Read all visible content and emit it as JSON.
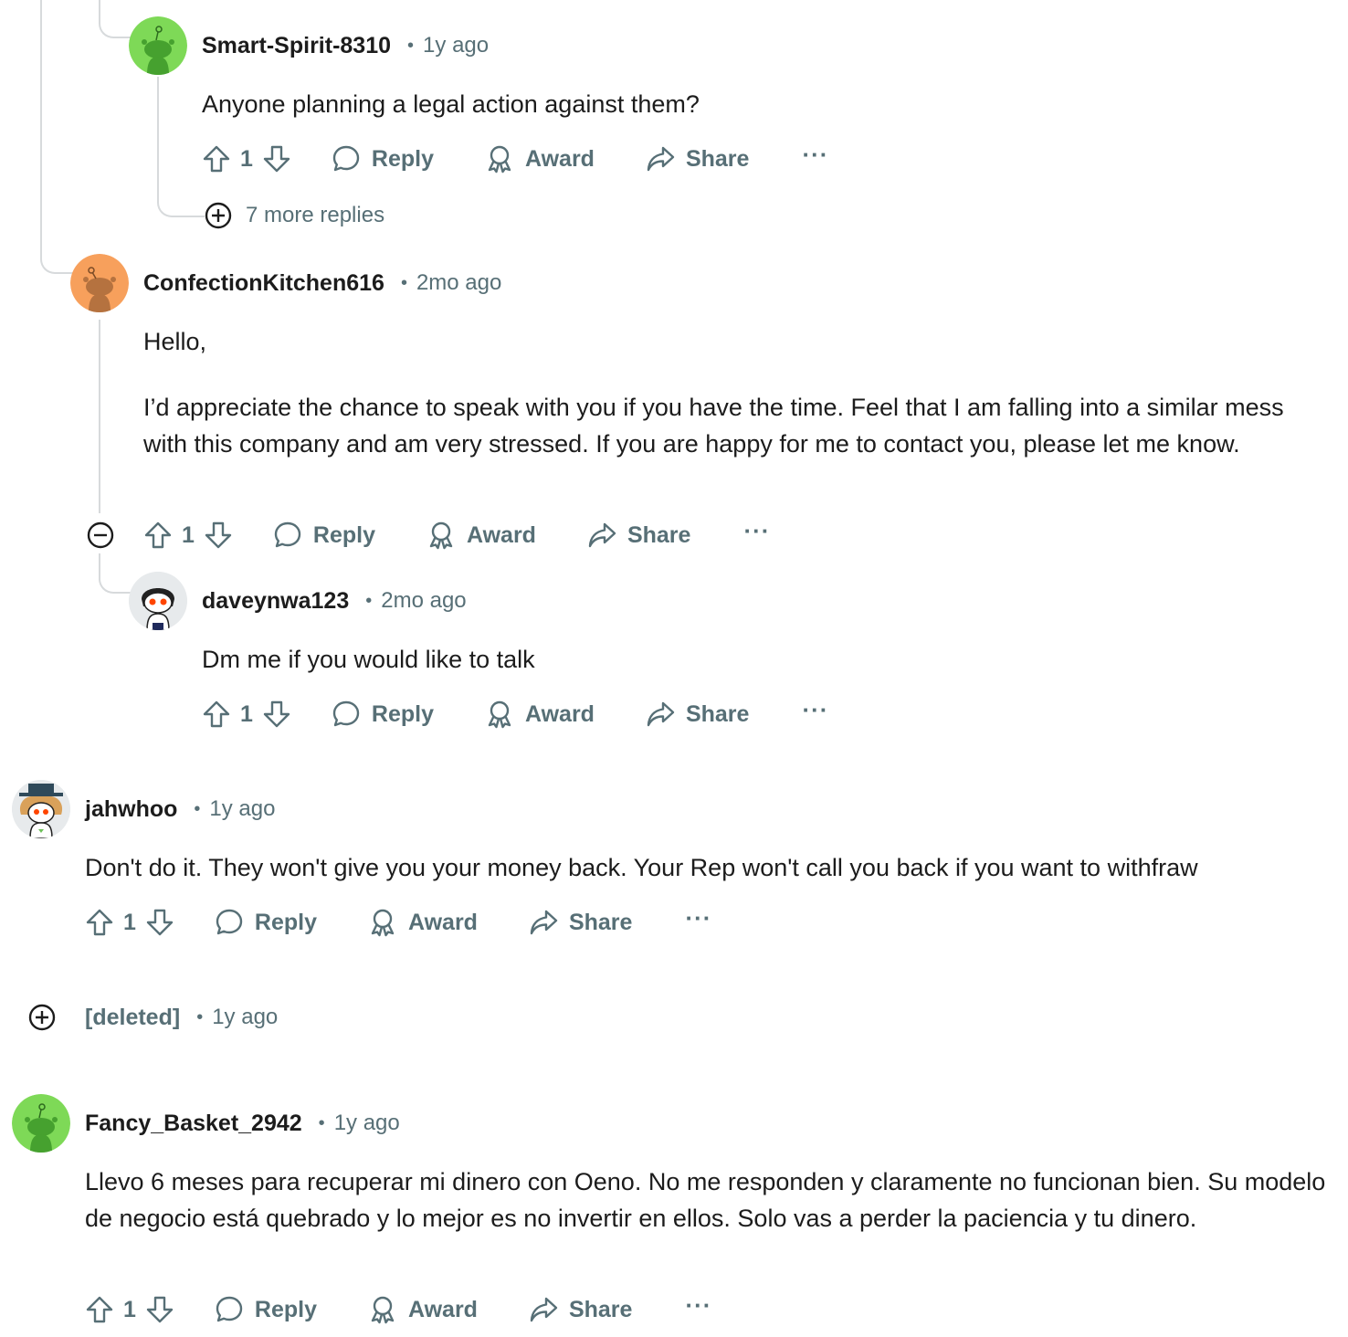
{
  "comments": [
    {
      "author": "Smart-Spirit-8310",
      "time": "1y ago",
      "body": [
        "Anyone planning a legal action against them?"
      ],
      "votes": "1",
      "avatar_color": "#7ed957",
      "more_replies": "7 more replies"
    },
    {
      "author": "ConfectionKitchen616",
      "time": "2mo ago",
      "body": [
        "Hello,",
        "I’d appreciate the chance to speak with you if you have the time. Feel that I am falling into a similar mess with this company and am very stressed. If you are happy for me to contact you, please let me know."
      ],
      "votes": "1",
      "avatar_color": "#f7a05c"
    },
    {
      "author": "daveynwa123",
      "time": "2mo ago",
      "body": [
        "Dm me if you would like to talk"
      ],
      "votes": "1"
    },
    {
      "author": "jahwhoo",
      "time": "1y ago",
      "body": [
        "Don't do it. They won't give you your money back. Your Rep won't call you back if you want to withfraw"
      ],
      "votes": "1"
    },
    {
      "author": "[deleted]",
      "time": "1y ago"
    },
    {
      "author": "Fancy_Basket_2942",
      "time": "1y ago",
      "body": [
        "Llevo 6 meses para recuperar mi dinero con Oeno. No me responden y claramente no funcionan bien. Su modelo de negocio está quebrado y lo mejor es no invertir en ellos. Solo vas a perder la paciencia y tu dinero."
      ],
      "votes": "1",
      "avatar_color": "#7ed957"
    }
  ],
  "labels": {
    "reply": "Reply",
    "award": "Award",
    "share": "Share",
    "more": "···",
    "separator": "•"
  },
  "colors": {
    "meta_gray": "#576f76",
    "thread_line": "#d7dadc",
    "text": "#1c1c1c"
  }
}
